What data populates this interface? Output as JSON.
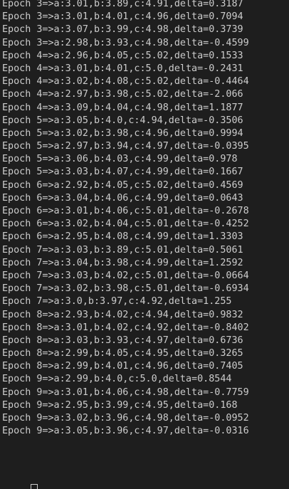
{
  "terminal": {
    "lines": [
      "Epoch 3=>a:3.01,b:3.89,c:4.91,delta=0.3187",
      "Epoch 3=>a:3.01,b:4.01,c:4.96,delta=0.7094",
      "Epoch 3=>a:3.07,b:3.99,c:4.98,delta=0.3739",
      "Epoch 3=>a:2.98,b:3.93,c:4.98,delta=-0.4599",
      "Epoch 4=>a:2.96,b:4.05,c:5.02,delta=0.1533",
      "Epoch 4=>a:3.01,b:4.01,c:5.0,delta=-0.2431",
      "Epoch 4=>a:3.02,b:4.08,c:5.02,delta=-0.4464",
      "Epoch 4=>a:2.97,b:3.98,c:5.02,delta=-2.066",
      "Epoch 4=>a:3.09,b:4.04,c:4.98,delta=1.1877",
      "Epoch 5=>a:3.05,b:4.0,c:4.94,delta=-0.3506",
      "Epoch 5=>a:3.02,b:3.98,c:4.96,delta=0.9994",
      "Epoch 5=>a:2.97,b:3.94,c:4.97,delta=-0.0395",
      "Epoch 5=>a:3.06,b:4.03,c:4.99,delta=0.978",
      "Epoch 5=>a:3.03,b:4.07,c:4.99,delta=0.1667",
      "Epoch 6=>a:2.92,b:4.05,c:5.02,delta=0.4569",
      "Epoch 6=>a:3.04,b:4.06,c:4.99,delta=0.0643",
      "Epoch 6=>a:3.01,b:4.06,c:5.01,delta=-0.2678",
      "Epoch 6=>a:3.02,b:4.04,c:5.01,delta=-0.4252",
      "Epoch 6=>a:2.95,b:4.08,c:4.99,delta=1.3303",
      "Epoch 7=>a:3.03,b:3.89,c:5.01,delta=0.5061",
      "Epoch 7=>a:3.04,b:3.98,c:4.99,delta=1.2592",
      "Epoch 7=>a:3.03,b:4.02,c:5.01,delta=-0.0664",
      "Epoch 7=>a:3.02,b:3.98,c:5.01,delta=-0.6934",
      "Epoch 7=>a:3.0,b:3.97,c:4.92,delta=1.255",
      "Epoch 8=>a:2.93,b:4.02,c:4.94,delta=0.9832",
      "Epoch 8=>a:3.01,b:4.02,c:4.92,delta=-0.8402",
      "Epoch 8=>a:3.03,b:3.93,c:4.97,delta=0.6736",
      "Epoch 8=>a:2.99,b:4.05,c:4.95,delta=0.3265",
      "Epoch 8=>a:2.99,b:4.01,c:4.96,delta=0.7405",
      "Epoch 9=>a:2.99,b:4.0,c:5.0,delta=0.8544",
      "Epoch 9=>a:3.01,b:4.06,c:4.98,delta=-0.7759",
      "Epoch 9=>a:2.95,b:3.99,c:4.95,delta=0.168",
      "Epoch 9=>a:3.02,b:3.96,c:4.98,delta=-0.0952",
      "Epoch 9=>a:3.05,b:3.96,c:4.97,delta=-0.0316"
    ]
  },
  "colors": {
    "background": "#1e1e1e",
    "text": "#cccccc"
  }
}
